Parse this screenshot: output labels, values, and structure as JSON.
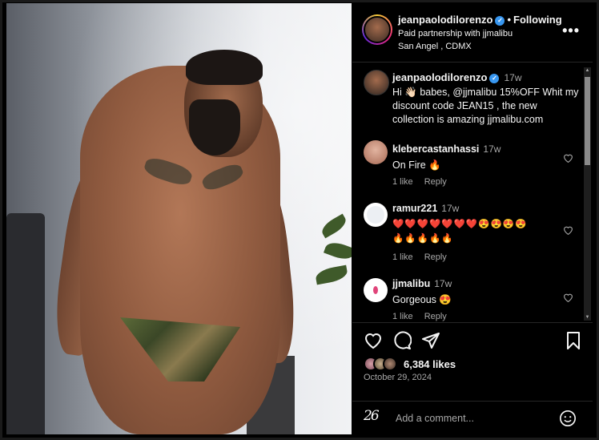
{
  "post": {
    "author": "jeanpaolodilorenzo",
    "following_label": "Following",
    "separator": "•",
    "partnership": "Paid partnership with jjmalibu",
    "location": "San Angel , CDMX",
    "more_label": "•••",
    "verified_mark": "✓"
  },
  "caption": {
    "user": "jeanpaolodilorenzo",
    "time": "17w",
    "text": "Hi 👋🏻 babes, @jjmalibu 15%OFF Whit my discount code JEAN15 , the new collection is amazing jjmalibu.com"
  },
  "comments": [
    {
      "user": "klebercastanhassi",
      "time": "17w",
      "text": "On Fire 🔥",
      "likes": "1 like",
      "reply": "Reply",
      "avatar_color": "#c58d7b"
    },
    {
      "user": "ramur221",
      "time": "17w",
      "line1": "❤️❤️❤️❤️❤️❤️❤️😍😍😍😍",
      "line2": "🔥🔥🔥🔥🔥",
      "likes": "1 like",
      "reply": "Reply",
      "avatar_color": "#e8e8ee"
    },
    {
      "user": "jjmalibu",
      "time": "17w",
      "text": "Gorgeous 😍",
      "likes": "1 like",
      "reply": "Reply",
      "avatar_color": "#ffffff"
    }
  ],
  "stats": {
    "likes": "6,384 likes",
    "date": "October 29, 2024"
  },
  "add_comment": {
    "logo_text": "26",
    "placeholder": "Add a comment..."
  },
  "icons": [
    "heart-icon",
    "comment-icon",
    "share-icon",
    "bookmark-icon",
    "emoji-icon",
    "more-icon",
    "verified-icon"
  ],
  "colors": {
    "background": "#000000",
    "text": "#f5f5f5",
    "muted": "#a8a8a8",
    "verified": "#3897f0",
    "divider": "#262626"
  }
}
